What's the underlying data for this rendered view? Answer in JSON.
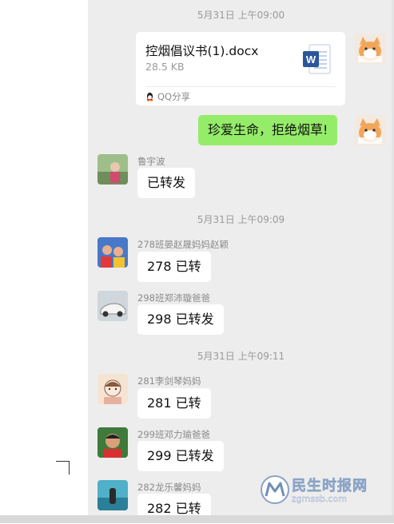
{
  "messages": {
    "timestamps": [
      "5月31日 上午09:00",
      "5月31日 上午09:09",
      "5月31日 上午09:11"
    ],
    "file_card": {
      "file_name": "控烟倡议书(1).docx",
      "file_size": "28.5 KB",
      "source": "QQ分享",
      "icon": "word-doc-icon"
    },
    "self_message": "珍爱生命，拒绝烟草!",
    "items": [
      {
        "sender": "鲁宇波",
        "text": "已转发"
      },
      {
        "sender": "278班晏赵晟妈妈赵颖",
        "text": "278 已转"
      },
      {
        "sender": "298班郑沛璇爸爸",
        "text": "298 已转发"
      },
      {
        "sender": "281李剑琴妈妈",
        "text": "281 已转"
      },
      {
        "sender": "299班邓力瑜爸爸",
        "text": "299 已转发"
      },
      {
        "sender": "282龙乐馨妈妈",
        "text": "282 已转"
      }
    ]
  },
  "watermark": {
    "title": "民生时报网",
    "url": "zgmssb.com"
  },
  "colors": {
    "chat_bg": "#ededed",
    "self_bubble": "#95ec69",
    "other_bubble": "#ffffff",
    "meta_text": "#9a9a9a",
    "word_blue": "#2b579a"
  }
}
